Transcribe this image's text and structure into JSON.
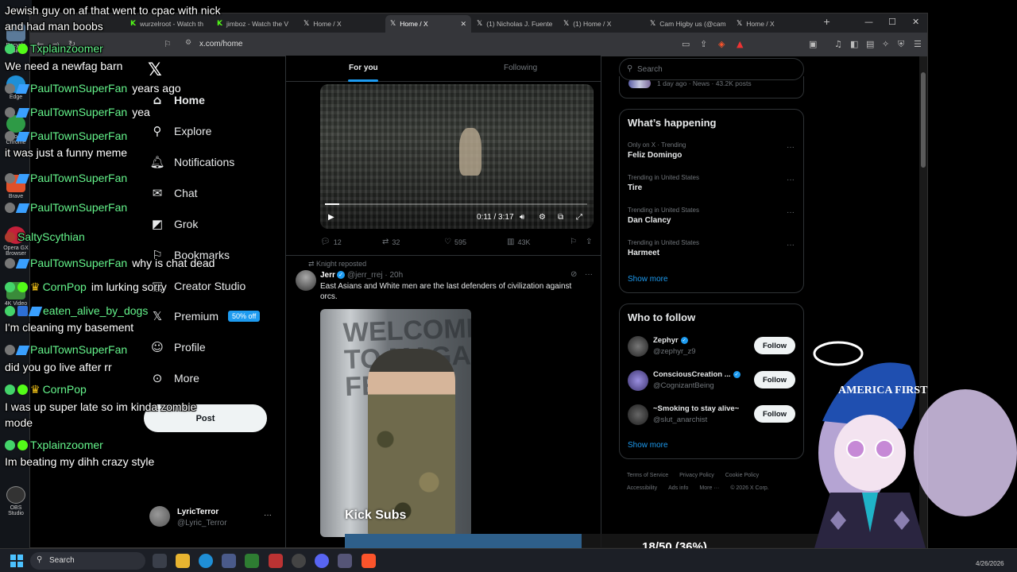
{
  "desktop": {
    "icons": [
      {
        "label": "Recycle Bin"
      },
      {
        "label": "Edge"
      },
      {
        "label": "Google Chrome"
      },
      {
        "label": "Brave"
      },
      {
        "label": "Opera GX Browser"
      },
      {
        "label": "4K Video"
      },
      {
        "label": "OBS Studio"
      }
    ]
  },
  "browser": {
    "tabs": [
      {
        "label": "wurzelroot - Watch th",
        "icon": "k"
      },
      {
        "label": "jimboz - Watch the V",
        "icon": "k"
      },
      {
        "label": "Home / X",
        "icon": "x"
      },
      {
        "label": "Home / X",
        "icon": "x",
        "active": true
      },
      {
        "label": "(1) Nicholas J. Fuente",
        "icon": "x"
      },
      {
        "label": "(1) Home / X",
        "icon": "x"
      },
      {
        "label": "Cam Higby us (@cam",
        "icon": "x"
      },
      {
        "label": "Home / X",
        "icon": "x"
      }
    ],
    "url": "x.com/home",
    "new_tab": "+",
    "win_min": "—",
    "win_max": "☐",
    "win_close": "✕"
  },
  "nav": {
    "logo": "𝕏",
    "items": [
      {
        "label": "Home",
        "icon": "⌂",
        "bold": true
      },
      {
        "label": "Explore",
        "icon": "⚲"
      },
      {
        "label": "Notifications",
        "icon": "🔔︎"
      },
      {
        "label": "Chat",
        "icon": "✉"
      },
      {
        "label": "Grok",
        "icon": "◩"
      },
      {
        "label": "Bookmarks",
        "icon": "⚐"
      },
      {
        "label": "Creator Studio",
        "icon": "▤"
      },
      {
        "label": "Premium",
        "icon": "𝕏"
      },
      {
        "label": "Profile",
        "icon": "☺"
      },
      {
        "label": "More",
        "icon": "⊙"
      }
    ],
    "premium_badge": "50% off",
    "post_button": "Post",
    "account": {
      "name": "LyricTerror",
      "handle": "@Lyric_Terror",
      "more": "···"
    }
  },
  "timeline": {
    "tabs": {
      "for_you": "For you",
      "following": "Following"
    },
    "video": {
      "time": "0:11 / 3:17",
      "progress": 0.056
    },
    "video_actions": {
      "replies": "12",
      "reposts": "32",
      "likes": "595",
      "views": "43K"
    },
    "tweet": {
      "repost_by": "Knight reposted",
      "name": "Jerr",
      "handle": "@jerr_rrej · 20h",
      "text": "East Asians and White men are the last defenders of civilization against orcs.",
      "image_wall_text": "WELCOME TO MAGA FEST"
    }
  },
  "sidebar": {
    "search_placeholder": "Search",
    "news_meta": "1 day ago · News · 43.2K posts",
    "happening_title": "What’s happening",
    "trends": [
      {
        "context": "Only on X · Trending",
        "name": "Feliz Domingo"
      },
      {
        "context": "Trending in United States",
        "name": "Tire"
      },
      {
        "context": "Trending in United States",
        "name": "Dan Clancy"
      },
      {
        "context": "Trending in United States",
        "name": "Harmeet"
      }
    ],
    "show_more": "Show more",
    "who_to_follow_title": "Who to follow",
    "follow_suggestions": [
      {
        "name": "Zephyr",
        "handle": "@zephyr_z9",
        "button": "Follow",
        "color": "#444"
      },
      {
        "name": "ConsciousCreation ...",
        "handle": "@CognizantBeing",
        "button": "Follow",
        "color": "#5a4fa0"
      },
      {
        "name": "~Smoking to stay alive~",
        "handle": "@slut_anarchist",
        "button": "Follow",
        "color": "#3a3a3a"
      }
    ],
    "show_more_2": "Show more",
    "footer": [
      "Terms of Service",
      "Privacy Policy",
      "Cookie Policy",
      "Accessibility",
      "Ads info",
      "More ···",
      "© 2026 X Corp."
    ]
  },
  "chat": [
    {
      "user": "",
      "msg": "Jewish guy on af that went to cpac with nick"
    },
    {
      "user": "",
      "msg": "and had man boobs"
    },
    {
      "user": "Txplainzoomer",
      "msg": "",
      "badges": "green"
    },
    {
      "user": "",
      "msg": "We need a newfag barn"
    },
    {
      "user": "PaulTownSuperFan",
      "msg": "years ago",
      "badges": "blue"
    },
    {
      "user": "PaulTownSuperFan",
      "msg": "yea",
      "badges": "blue"
    },
    {
      "user": "PaulTownSuperFan",
      "msg": "",
      "badges": "blue"
    },
    {
      "user": "",
      "msg": "it was just a funny meme"
    },
    {
      "user": "PaulTownSuperFan",
      "msg": "",
      "badges": "blue"
    },
    {
      "user": "PaulTownSuperFan",
      "msg": "",
      "badges": "blue"
    },
    {
      "user": "SaltyScythian",
      "msg": "",
      "badges": "none"
    },
    {
      "user": "PaulTownSuperFan",
      "msg": "why is chat dead",
      "badges": "blue"
    },
    {
      "user": "CornPop",
      "msg": "im lurking sorry",
      "badges": "crown"
    },
    {
      "user": "eaten_alive_by_dogs",
      "msg": "",
      "badges": "blue"
    },
    {
      "user": "",
      "msg": "I'm cleaning my basement"
    },
    {
      "user": "PaulTownSuperFan",
      "msg": "",
      "badges": "blue"
    },
    {
      "user": "",
      "msg": "did you go live after rr"
    },
    {
      "user": "CornPop",
      "msg": "",
      "badges": "crown"
    },
    {
      "user": "",
      "msg": "I was up super late so im kinda zombie"
    },
    {
      "user": "",
      "msg": "mode"
    },
    {
      "user": "Txplainzoomer",
      "msg": "",
      "badges": "green"
    },
    {
      "user": "",
      "msg": "Im beating my dihh crazy style"
    }
  ],
  "overlay": {
    "kick_subs": "Kick Subs",
    "sub_progress_label": "18/50 (36%)",
    "sub_progress": 0.36,
    "vtuber_hat_text": "AMERICA FIRST"
  },
  "taskbar": {
    "search_placeholder": "Search",
    "clock_date": "4/26/2026"
  },
  "colors": {
    "accent": "#1d9bf0",
    "chat_name": "#65f58c",
    "bg": "#000000"
  }
}
